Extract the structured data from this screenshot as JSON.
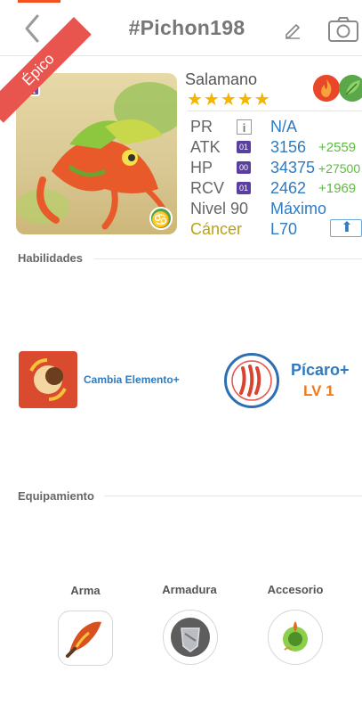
{
  "header": {
    "title": "#Pichon198"
  },
  "card": {
    "name": "Salamano",
    "stars": "★★★★★",
    "rarity_badge": "R",
    "rarity_label": "Épico",
    "zodiac_symbol": "♋",
    "elements": [
      "fire",
      "grass"
    ]
  },
  "stats": {
    "pr_label": "PR",
    "pr_value": "N/A",
    "atk_label": "ATK",
    "atk_badge": "01",
    "atk_value": "3156",
    "atk_bonus": "+2559",
    "hp_label": "HP",
    "hp_badge": "00",
    "hp_value": "34375",
    "hp_bonus": "+27500",
    "rcv_label": "RCV",
    "rcv_badge": "01",
    "rcv_value": "2462",
    "rcv_bonus": "+1969",
    "level_label": "Nivel 90",
    "level_value": "Máximo",
    "sign_label": "Cáncer",
    "sign_value": "L70"
  },
  "sections": {
    "habilidades": "Habilidades",
    "equipamiento": "Equipamiento"
  },
  "skills": {
    "skill1_name": "Cambia Elemento+",
    "skill2_name": "Pícaro+",
    "skill2_level": "LV 1"
  },
  "equipment": {
    "arma": "Arma",
    "armadura": "Armadura",
    "accesorio": "Accesorio"
  },
  "colors": {
    "accent_blue": "#2e7bc2",
    "bonus_green": "#5cbc3c",
    "gold": "#f5b400",
    "orange": "#f07a1a"
  }
}
